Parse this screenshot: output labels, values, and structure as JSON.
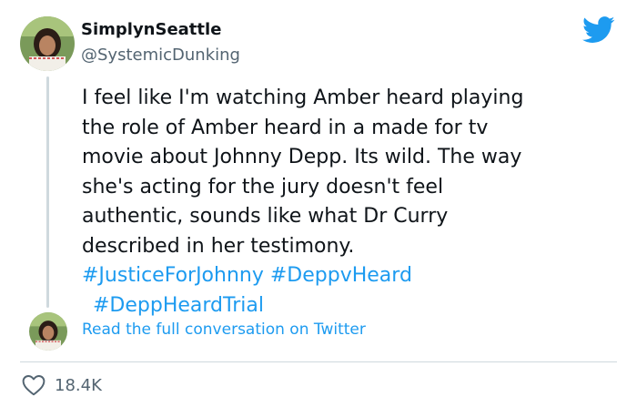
{
  "tweet": {
    "author": {
      "display_name": "SimplynSeattle",
      "handle": "@SystemicDunking",
      "avatar_icon": "profile-photo"
    },
    "brand_icon": "twitter-bird-icon",
    "text_lines": [
      "I feel like I'm watching Amber heard playing",
      "the role of Amber heard in a made for tv",
      "movie about Johnny Depp. Its wild. The way",
      "she's acting for the jury doesn't feel",
      "authentic, sounds like what Dr Curry",
      "described in her testimony."
    ],
    "hashtags": [
      "#JusticeForJohnny",
      "#DeppvHeard",
      "#DeppHeardTrial"
    ],
    "read_more_label": "Read the full conversation on Twitter",
    "likes": "18.4K"
  },
  "colors": {
    "accent": "#1d9bf0",
    "text": "#0f1419",
    "muted": "#536471",
    "divider": "#cfd9de"
  }
}
